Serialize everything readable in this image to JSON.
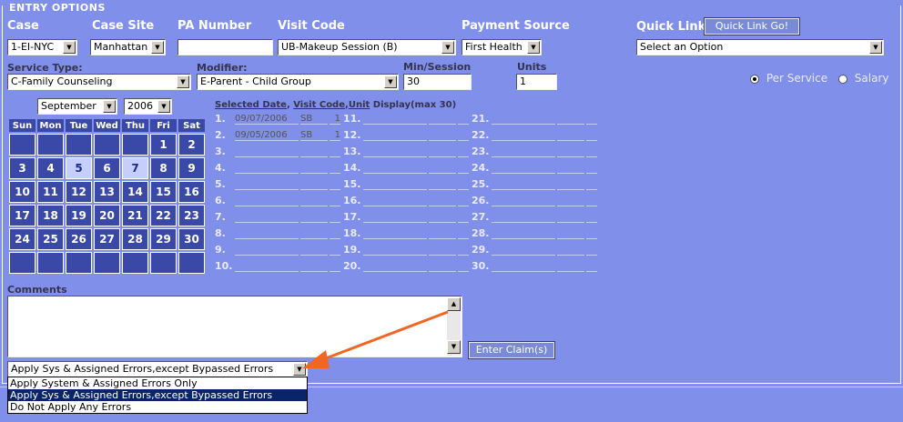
{
  "section_title": "ENTRY OPTIONS",
  "headers": {
    "case": "Case",
    "case_site": "Case Site",
    "pa_number": "PA Number",
    "visit_code": "Visit Code",
    "payment_source": "Payment Source",
    "quick_link": "Quick Link"
  },
  "fields": {
    "case": "1-EI-NYC",
    "case_site": "Manhattan",
    "pa_number": "",
    "visit_code": "UB-Makeup Session (B)",
    "payment_source": "First Health",
    "quick_link": "Select an Option",
    "quick_link_button": "Quick Link Go!"
  },
  "labels": {
    "service_type": "Service Type:",
    "modifier": "Modifier:",
    "min_session": "Min/Session",
    "units": "Units",
    "comments": "Comments"
  },
  "values": {
    "service_type": "C-Family Counseling",
    "modifier": "E-Parent - Child Group",
    "min_session": "30",
    "units": "1"
  },
  "rate": {
    "per_service": "Per Service",
    "salary": "Salary",
    "selected": "per_service"
  },
  "calendar": {
    "month": "September",
    "year": "2006",
    "days": [
      "Sun",
      "Mon",
      "Tue",
      "Wed",
      "Thu",
      "Fri",
      "Sat"
    ],
    "weeks": [
      [
        "",
        "",
        "",
        "",
        "",
        "1",
        "2"
      ],
      [
        "3",
        "4",
        "5",
        "6",
        "7",
        "8",
        "9"
      ],
      [
        "10",
        "11",
        "12",
        "13",
        "14",
        "15",
        "16"
      ],
      [
        "17",
        "18",
        "19",
        "20",
        "21",
        "22",
        "23"
      ],
      [
        "24",
        "25",
        "26",
        "27",
        "28",
        "29",
        "30"
      ],
      [
        "",
        "",
        "",
        "",
        "",
        "",
        ""
      ]
    ],
    "selected": [
      "5",
      "7"
    ]
  },
  "selection_header": {
    "date": "Selected Date",
    "code": "Visit Code",
    "unit": "Unit",
    "rest": " Display(max 30)"
  },
  "selections": [
    {
      "n": "1.",
      "date": "09/07/2006",
      "code": "SB",
      "unit": "1"
    },
    {
      "n": "2.",
      "date": "09/05/2006",
      "code": "SB",
      "unit": "1"
    }
  ],
  "slot_numbers": [
    "1.",
    "2.",
    "3.",
    "4.",
    "5.",
    "6.",
    "7.",
    "8.",
    "9.",
    "10.",
    "11.",
    "12.",
    "13.",
    "14.",
    "15.",
    "16.",
    "17.",
    "18.",
    "19.",
    "20.",
    "21.",
    "22.",
    "23.",
    "24.",
    "25.",
    "26.",
    "27.",
    "28.",
    "29.",
    "30."
  ],
  "enter_claims": "Enter Claim(s)",
  "error_mode": {
    "selected": "Apply Sys & Assigned Errors,except Bypassed Errors",
    "options": [
      "Apply System & Assigned Errors Only",
      "Apply Sys & Assigned Errors,except Bypassed Errors",
      "Do Not Apply Any Errors"
    ]
  },
  "colors": {
    "background": "#7f8fea",
    "calendar_cell": "#3a48a8",
    "highlight": "#0a246a",
    "arrow": "#f26522"
  }
}
